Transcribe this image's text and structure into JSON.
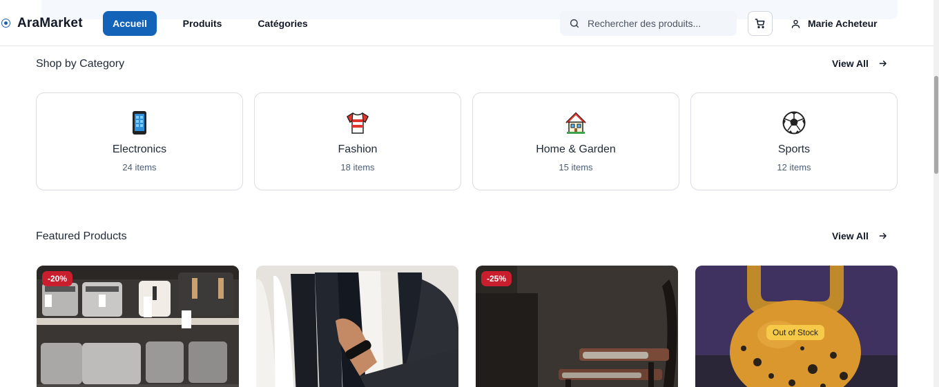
{
  "header": {
    "logo": "AraMarket",
    "nav": [
      {
        "label": "Accueil",
        "active": true
      },
      {
        "label": "Produits",
        "active": false
      },
      {
        "label": "Catégories",
        "active": false
      }
    ],
    "search_placeholder": "Rechercher des produits...",
    "user_name": "Marie Acheteur"
  },
  "categories_section": {
    "title": "Shop by Category",
    "view_all": "View All",
    "items": [
      {
        "icon": "mobile-phone-icon",
        "name": "Electronics",
        "count": "24 items"
      },
      {
        "icon": "shirt-icon",
        "name": "Fashion",
        "count": "18 items"
      },
      {
        "icon": "house-icon",
        "name": "Home & Garden",
        "count": "15 items"
      },
      {
        "icon": "soccer-ball-icon",
        "name": "Sports",
        "count": "12 items"
      }
    ]
  },
  "featured_section": {
    "title": "Featured Products",
    "view_all": "View All",
    "products": [
      {
        "image": "toasters-on-shelves",
        "badge": "-20%"
      },
      {
        "image": "clothes-rack",
        "badge": ""
      },
      {
        "image": "dark-room-chair",
        "badge": "-25%"
      },
      {
        "image": "kettlebell",
        "badge": "",
        "stock_label": "Out of Stock"
      }
    ]
  },
  "colors": {
    "accent": "#1363b8",
    "discount_badge": "#c81e2e",
    "stock_badge": "#f7c948"
  }
}
